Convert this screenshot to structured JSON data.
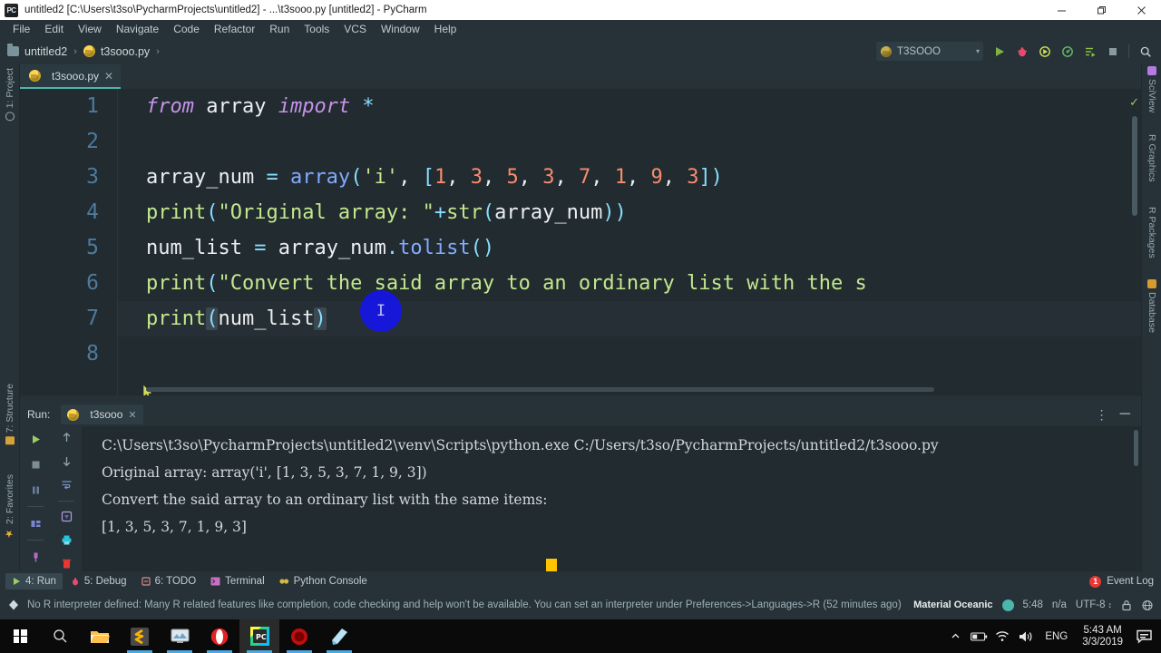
{
  "window": {
    "title": "untitled2 [C:\\Users\\t3so\\PycharmProjects\\untitled2] - ...\\t3sooo.py [untitled2] - PyCharm",
    "app_icon": "pycharm-icon",
    "minimize_label": "─",
    "maximize_label": "❐",
    "close_label": "✕"
  },
  "menubar": {
    "items": [
      {
        "label": "File"
      },
      {
        "label": "Edit"
      },
      {
        "label": "View"
      },
      {
        "label": "Navigate"
      },
      {
        "label": "Code"
      },
      {
        "label": "Refactor"
      },
      {
        "label": "Run"
      },
      {
        "label": "Tools"
      },
      {
        "label": "VCS"
      },
      {
        "label": "Window"
      },
      {
        "label": "Help"
      }
    ]
  },
  "breadcrumb": {
    "project": "untitled2",
    "file": "t3sooo.py",
    "separator": "›"
  },
  "toolbar": {
    "run_config": "T3SOOO",
    "chevron": "▾",
    "buttons": [
      {
        "name": "run-button",
        "title": "Run"
      },
      {
        "name": "debug-button",
        "title": "Debug"
      },
      {
        "name": "run-with-coverage-button",
        "title": "Run with Coverage"
      },
      {
        "name": "profile-button",
        "title": "Profile"
      },
      {
        "name": "edit-configurations-button",
        "title": "Edit Configurations"
      },
      {
        "name": "stop-button",
        "title": "Stop"
      },
      {
        "name": "search-everywhere-button",
        "title": "Search Everywhere"
      }
    ]
  },
  "left_strip": {
    "items": [
      {
        "label": "1: Project",
        "icon": "project-icon"
      },
      {
        "label": "7: Structure",
        "icon": "structure-icon"
      },
      {
        "label": "2: Favorites",
        "icon": "star-icon"
      }
    ]
  },
  "right_strip": {
    "items": [
      {
        "label": "SciView",
        "icon": "sciview-icon"
      },
      {
        "label": "R Graphics",
        "icon": "none"
      },
      {
        "label": "R Packages",
        "icon": "none"
      },
      {
        "label": "Database",
        "icon": "database-icon"
      }
    ]
  },
  "editor": {
    "tab": {
      "label": "t3sooo.py",
      "close": "✕",
      "icon": "python-file-icon"
    },
    "line_numbers": [
      "1",
      "2",
      "3",
      "4",
      "5",
      "6",
      "7",
      "8"
    ],
    "lines": [
      {
        "n": 1,
        "text": "from array import *"
      },
      {
        "n": 2,
        "text": ""
      },
      {
        "n": 3,
        "text": "array_num = array('i', [1, 3, 5, 3, 7, 1, 9, 3])"
      },
      {
        "n": 4,
        "text": "print(\"Original array: \"+str(array_num))"
      },
      {
        "n": 5,
        "text": "num_list = array_num.tolist()"
      },
      {
        "n": 6,
        "text": "print(\"Convert the said array to an ordinary list with the s"
      },
      {
        "n": 7,
        "text": "print(num_list)"
      },
      {
        "n": 8,
        "text": ""
      }
    ],
    "inspection_status": "✓"
  },
  "run_window": {
    "title": "Run:",
    "tab_label": "t3sooo",
    "tab_close": "✕",
    "options_icon": "⋮",
    "hide_icon": "─",
    "output": [
      "C:\\Users\\t3so\\PycharmProjects\\untitled2\\venv\\Scripts\\python.exe C:/Users/t3so/PycharmProjects/untitled2/t3sooo.py",
      "Original array: array('i', [1, 3, 5, 3, 7, 1, 9, 3])",
      "Convert the said array to an ordinary list with the same items:",
      "[1, 3, 5, 3, 7, 1, 9, 3]"
    ],
    "tool_buttons": [
      {
        "name": "rerun-button"
      },
      {
        "name": "stop-button"
      },
      {
        "name": "pause-button"
      },
      {
        "name": "layout-button"
      },
      {
        "name": "pin-tab-button"
      },
      {
        "name": "up-arrow-button"
      },
      {
        "name": "down-arrow-button"
      },
      {
        "name": "soft-wrap-button"
      },
      {
        "name": "scroll-to-end-button"
      },
      {
        "name": "print-button"
      },
      {
        "name": "clear-all-button"
      }
    ]
  },
  "bottom_bar": {
    "items": [
      {
        "label": "4: Run",
        "icon": "run-icon",
        "active": true
      },
      {
        "label": "5: Debug",
        "icon": "debug-icon",
        "active": false
      },
      {
        "label": "6: TODO",
        "icon": "todo-icon",
        "active": false
      },
      {
        "label": "Terminal",
        "icon": "terminal-icon",
        "active": false
      },
      {
        "label": "Python Console",
        "icon": "python-console-icon",
        "active": false
      }
    ],
    "event_log": {
      "label": "Event Log",
      "badge": "1"
    }
  },
  "status_bar": {
    "message": "No R interpreter defined: Many R related features like completion, code checking and help won't be available. You can set an interpreter under Preferences->Languages->R (52 minutes ago)",
    "theme": "Material Oceanic",
    "position": "5:48",
    "line_separator": "n/a",
    "encoding": "UTF-8",
    "encoding_chevron": "↕",
    "lock_icon": "lock-icon",
    "python_icon": "interpreter-icon"
  },
  "taskbar": {
    "apps": [
      {
        "name": "start-button",
        "icon": "windows-logo"
      },
      {
        "name": "search-button",
        "icon": "search-icon"
      },
      {
        "name": "file-explorer",
        "icon": "folder-icon"
      },
      {
        "name": "sublime-text",
        "icon": "sublime-icon"
      },
      {
        "name": "media-app",
        "icon": "monitor-icon"
      },
      {
        "name": "opera-browser",
        "icon": "opera-icon"
      },
      {
        "name": "pycharm",
        "icon": "pycharm-icon"
      },
      {
        "name": "recorder-app",
        "icon": "record-icon"
      },
      {
        "name": "notes-app",
        "icon": "notes-icon"
      }
    ],
    "tray": {
      "chevron": "∧",
      "language": "ENG",
      "time": "5:43 AM",
      "date": "3/3/2019"
    }
  },
  "colors": {
    "ide_bg": "#263238",
    "editor_bg": "#212b30",
    "accent": "#4db6ac",
    "keyword": "#c792ea",
    "string": "#c3e88d",
    "number": "#f78c6c",
    "operator": "#89ddff",
    "builtin": "#82aaff"
  }
}
